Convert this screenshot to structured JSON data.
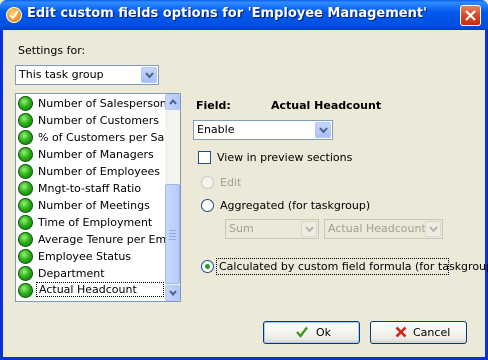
{
  "window": {
    "title": "Edit custom fields options for  'Employee Management'"
  },
  "settings": {
    "label": "Settings for:",
    "selected": "This task group"
  },
  "list": {
    "items": [
      "Number of Salespersons",
      "Number of Customers",
      "% of Customers per Salesp",
      "Number of Managers",
      "Number of Employees",
      "Mngt-to-staff Ratio",
      "Number of Meetings",
      "Time of Employment",
      "Average Tenure per Emplo",
      "Employee Status",
      "Department",
      "Actual Headcount"
    ],
    "selected_index": 11
  },
  "field": {
    "label": "Field:",
    "name": "Actual Headcount",
    "mode": "Enable"
  },
  "options": {
    "view_in_preview": "View in preview sections",
    "edit": "Edit",
    "aggregated": "Aggregated (for taskgroup)",
    "agg_function": "Sum",
    "agg_field": "Actual Headcount",
    "calculated": "Calculated by custom field formula (for taskgroup)"
  },
  "buttons": {
    "ok": "Ok",
    "cancel": "Cancel"
  },
  "colors": {
    "titlebar": "#0058ee",
    "status_green": "#2fb31a",
    "cancel_x": "#d42010",
    "ok_check": "#3a9a1c"
  }
}
